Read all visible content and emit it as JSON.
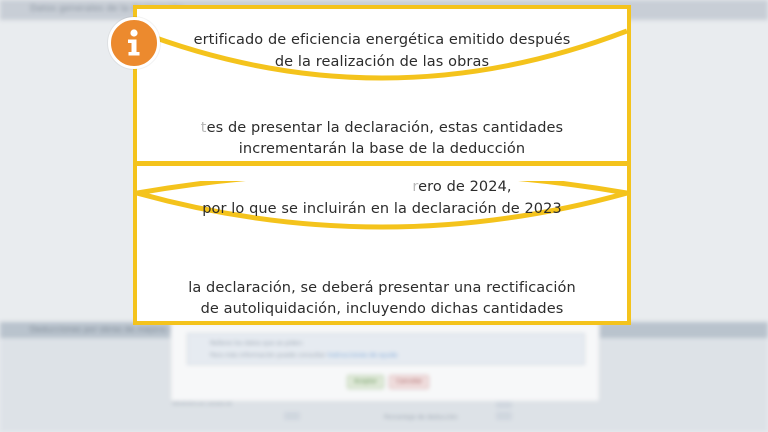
{
  "background": {
    "header_label": "Datos generales de la declaración",
    "band_label": "Deducciones por obras de mejora de la eficiencia energética en viviendas",
    "dialog_text_1": "Rellene los datos que se piden:",
    "dialog_text_2": "Para más información puede consultar",
    "dialog_link": "Instrucciones de ayuda",
    "ok_label": "Aceptar",
    "cancel_label": "Cancelar",
    "field_label_1": "Referencia catastral",
    "field_label_2": "Porcentaje de deducción"
  },
  "info_card": {
    "line1": "ertificado de eficiencia energética emitido después",
    "line2": "de la realización de las obras",
    "line3_ghost": "t",
    "line3": "es de presentar la declaración, estas cantidades",
    "line4": "incrementarán la base de la deducción",
    "line5_ghost": "r",
    "line5": "ero de 2024,",
    "line6": "por lo que se incluirán en la declaración de 2023",
    "line7": "la declaración, se deberá presentar una rectificación",
    "line8": "de autoliquidación, incluyendo dichas cantidades"
  },
  "colors": {
    "accent": "#f4c31c",
    "badge": "#ec8a2e"
  },
  "icons": {
    "badge": "info-icon"
  }
}
